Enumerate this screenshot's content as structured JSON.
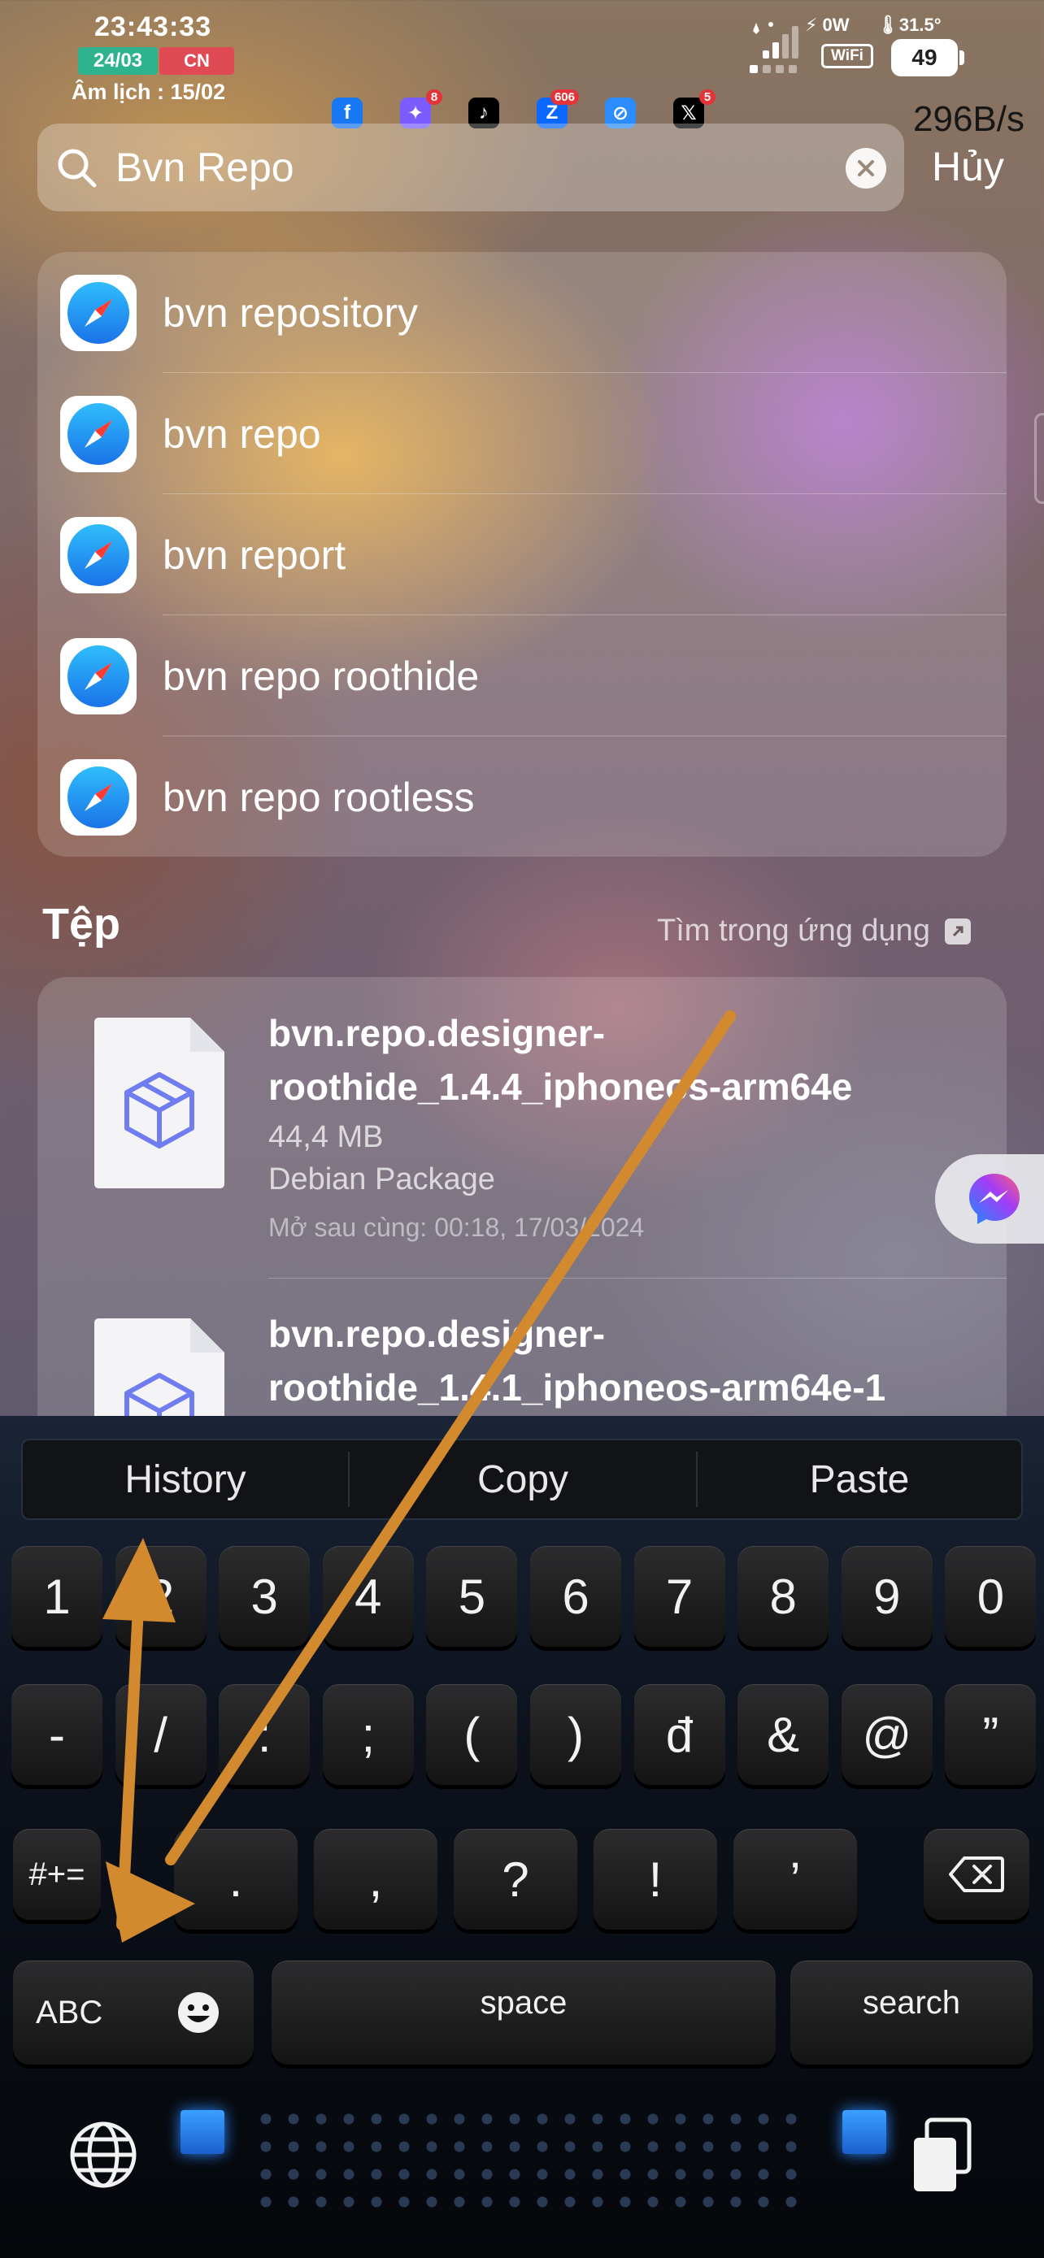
{
  "status": {
    "time": "23:43:33",
    "date_badge": "24/03",
    "cn_badge": "CN",
    "lunar": "Âm lịch : 15/02",
    "power": "⚡ 0W",
    "temperature": "🌡31.5°",
    "wifi_label": "WiFi",
    "battery": "49",
    "net_speed": "296B/s"
  },
  "notifications": [
    {
      "app": "Facebook",
      "glyph": "f",
      "color": "#1877f2",
      "badge": ""
    },
    {
      "app": "Messenger",
      "glyph": "✦",
      "color": "#7b5cff",
      "badge": "8"
    },
    {
      "app": "TikTok",
      "glyph": "♪",
      "color": "#000000",
      "badge": ""
    },
    {
      "app": "Zalo",
      "glyph": "Z",
      "color": "#0a68ff",
      "badge": "606"
    },
    {
      "app": "Safari",
      "glyph": "⊘",
      "color": "#2b8cff",
      "badge": ""
    },
    {
      "app": "X",
      "glyph": "𝕏",
      "color": "#000000",
      "badge": "5"
    }
  ],
  "search": {
    "query": "Bvn Repo",
    "cancel_label": "Hủy"
  },
  "suggestions": [
    "bvn repository",
    "bvn repo",
    "bvn report",
    "bvn repo roothide",
    "bvn repo rootless"
  ],
  "files_section": {
    "heading": "Tệp",
    "search_in_app": "Tìm trong ứng dụng",
    "items": [
      {
        "name_line1": "bvn.repo.designer-",
        "name_line2": "roothide_1.4.4_iphoneos-arm64e",
        "size": "44,4 MB",
        "type": "Debian Package",
        "last_opened": "Mở sau cùng: 00:18, 17/03/2024"
      },
      {
        "name_line1": "bvn.repo.designer-",
        "name_line2": "roothide_1.4.1_iphoneos-arm64e-1"
      }
    ]
  },
  "keyboard": {
    "toolbar": [
      "History",
      "Copy",
      "Paste"
    ],
    "row1": [
      "1",
      "2",
      "3",
      "4",
      "5",
      "6",
      "7",
      "8",
      "9",
      "0"
    ],
    "row2": [
      "-",
      "/",
      ":",
      ";",
      "(",
      ")",
      "đ",
      "&",
      "@",
      "”"
    ],
    "row3": [
      ".",
      ",",
      "?",
      "!",
      "’"
    ],
    "mode_key": "#+=",
    "abc_key": "ABC",
    "space_key": "space",
    "search_key": "search"
  },
  "colors": {
    "annotation_arrow": "#d38a2e",
    "key_glow": "#2a86ff"
  }
}
